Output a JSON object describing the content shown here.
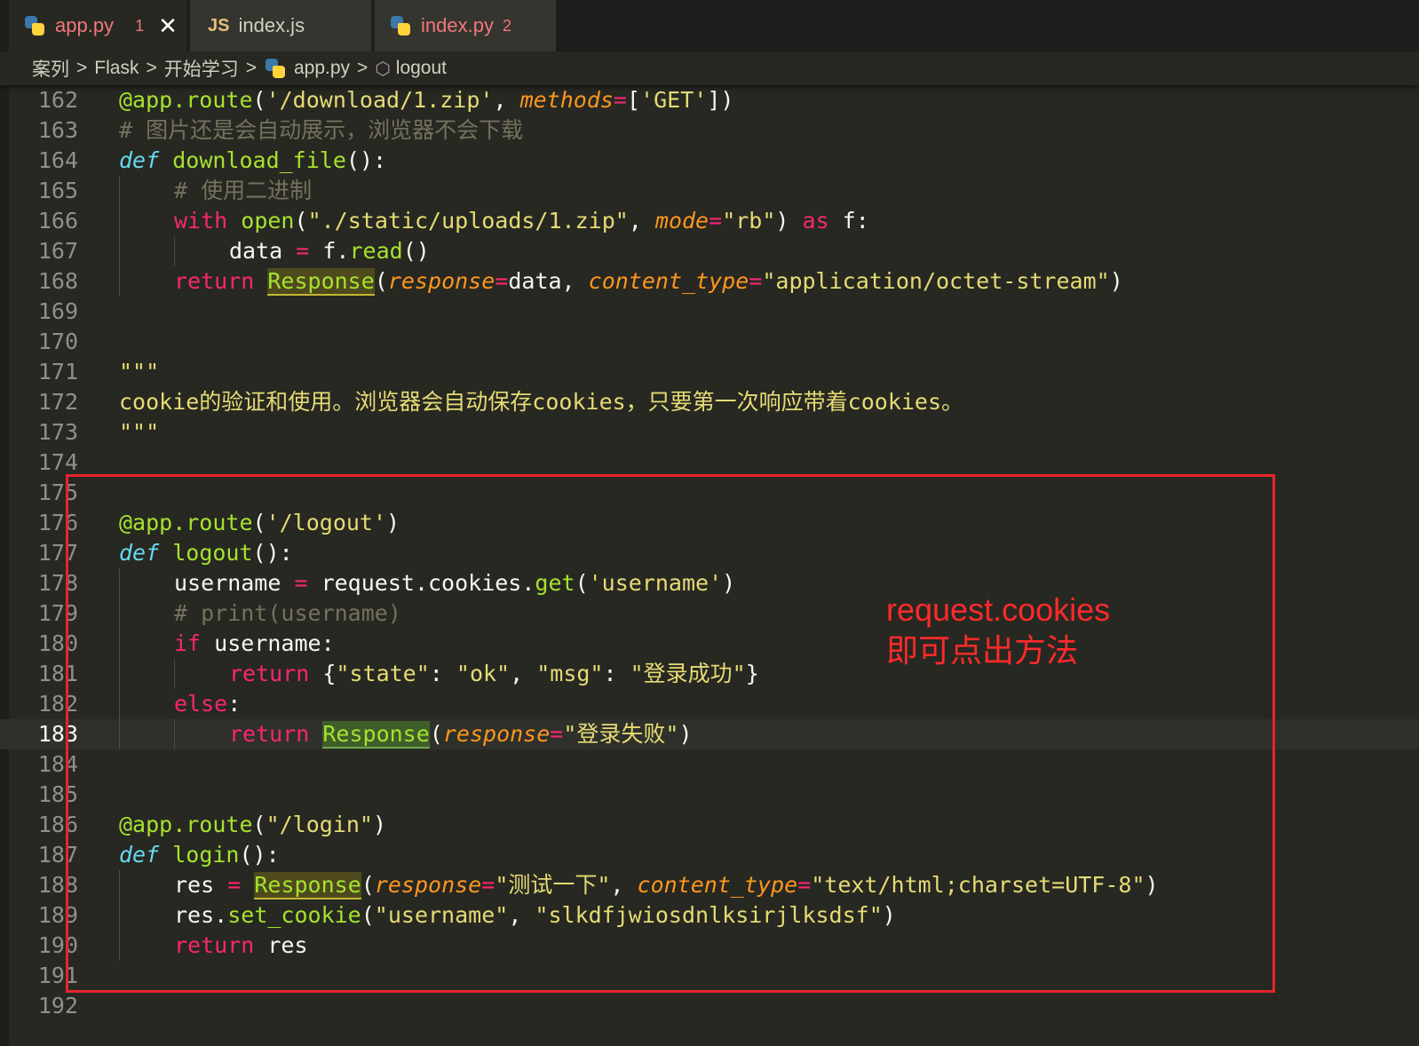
{
  "tabs": [
    {
      "label": "app.py",
      "icon": "python-icon",
      "badge": "1",
      "close": "✕",
      "active": true
    },
    {
      "label": "index.js",
      "icon": "js-icon",
      "icon_text": "JS"
    },
    {
      "label": "index.py",
      "icon": "python-icon",
      "badge": "2"
    }
  ],
  "breadcrumb": [
    "案列",
    "Flask",
    "开始学习",
    "app.py",
    "logout"
  ],
  "breadcrumb_sep": ">",
  "annotation": {
    "line1": "request.cookies",
    "line2": "即可点出方法",
    "color": "#e8242c"
  },
  "current_line": 183,
  "lines": [
    {
      "n": "162"
    },
    {
      "n": "163"
    },
    {
      "n": "164"
    },
    {
      "n": "165"
    },
    {
      "n": "166"
    },
    {
      "n": "167"
    },
    {
      "n": "168"
    },
    {
      "n": "169"
    },
    {
      "n": "170"
    },
    {
      "n": "171"
    },
    {
      "n": "172"
    },
    {
      "n": "173"
    },
    {
      "n": "174"
    },
    {
      "n": "175"
    },
    {
      "n": "176"
    },
    {
      "n": "177"
    },
    {
      "n": "178"
    },
    {
      "n": "179"
    },
    {
      "n": "180"
    },
    {
      "n": "181"
    },
    {
      "n": "182"
    },
    {
      "n": "183"
    },
    {
      "n": "184"
    },
    {
      "n": "185"
    },
    {
      "n": "186"
    },
    {
      "n": "187"
    },
    {
      "n": "188"
    },
    {
      "n": "189"
    },
    {
      "n": "190"
    },
    {
      "n": "191"
    },
    {
      "n": "192"
    }
  ],
  "code": {
    "l162": {
      "dec": "@app.route",
      "p1": "(",
      "s1": "'/download/1.zip'",
      "c1": ", ",
      "param": "methods",
      "eq": "=",
      "b1": "[",
      "s2": "'GET'",
      "b2": "])"
    },
    "l163": {
      "comment": "# 图片还是会自动展示，浏览器不会下载"
    },
    "l164": {
      "kw": "def",
      "sp": " ",
      "fn": "download_file",
      "rest": "():"
    },
    "l165": {
      "comment": "# 使用二进制"
    },
    "l166": {
      "kw": "with",
      "sp": " ",
      "fn": "open",
      "p1": "(",
      "s1": "\"./static/uploads/1.zip\"",
      "c1": ", ",
      "param": "mode",
      "eq": "=",
      "s2": "\"rb\"",
      "p2": ") ",
      "kw2": "as",
      "rest": " f:"
    },
    "l167": {
      "a": "data ",
      "op": "=",
      "b": " f.",
      "fn": "read",
      "rest": "()"
    },
    "l168": {
      "kw": "return",
      "sp": " ",
      "cls": "Response",
      "p1": "(",
      "param1": "response",
      "eq1": "=",
      "v1": "data, ",
      "param2": "content_type",
      "eq2": "=",
      "s1": "\"application/octet-stream\"",
      "p2": ")"
    },
    "l171": {
      "s": "\"\"\""
    },
    "l172": {
      "s": "cookie的验证和使用。浏览器会自动保存cookies，只要第一次响应带着cookies。"
    },
    "l173": {
      "s": "\"\"\""
    },
    "l176": {
      "dec": "@app.route",
      "p1": "(",
      "s1": "'/logout'",
      "p2": ")"
    },
    "l177": {
      "kw": "def",
      "sp": " ",
      "fn": "logout",
      "rest": "():"
    },
    "l178": {
      "a": "username ",
      "op": "=",
      "b": " request.cookies.",
      "fn": "get",
      "p1": "(",
      "s1": "'username'",
      "p2": ")"
    },
    "l179": {
      "comment": "# print(username)"
    },
    "l180": {
      "kw": "if",
      "rest": " username:"
    },
    "l181": {
      "kw": "return",
      "rest1": " {",
      "s1": "\"state\"",
      "c1": ": ",
      "s2": "\"ok\"",
      "c2": ", ",
      "s3": "\"msg\"",
      "c3": ": ",
      "s4": "\"登录成功\"",
      "rest2": "}"
    },
    "l182": {
      "kw": "else",
      "rest": ":"
    },
    "l183": {
      "kw": "return",
      "sp": " ",
      "cls": "Response",
      "p1": "(",
      "param": "response",
      "eq": "=",
      "s1": "\"登录失败\"",
      "p2": ")"
    },
    "l186": {
      "dec": "@app.route",
      "p1": "(",
      "s1": "\"/login\"",
      "p2": ")"
    },
    "l187": {
      "kw": "def",
      "sp": " ",
      "fn": "login",
      "rest": "():"
    },
    "l188": {
      "a": "res ",
      "op": "=",
      "sp": " ",
      "cls": "Response",
      "p1": "(",
      "param1": "response",
      "eq1": "=",
      "s1": "\"测试一下\"",
      "c1": ", ",
      "param2": "content_type",
      "eq2": "=",
      "s2": "\"text/html;charset=UTF-8\"",
      "p2": ")"
    },
    "l189": {
      "a": "res.",
      "fn": "set_cookie",
      "p1": "(",
      "s1": "\"username\"",
      "c1": ", ",
      "s2": "\"slkdfjwiosdnlksirjlksdsf\"",
      "p2": ")"
    },
    "l190": {
      "kw": "return",
      "rest": " res"
    }
  }
}
